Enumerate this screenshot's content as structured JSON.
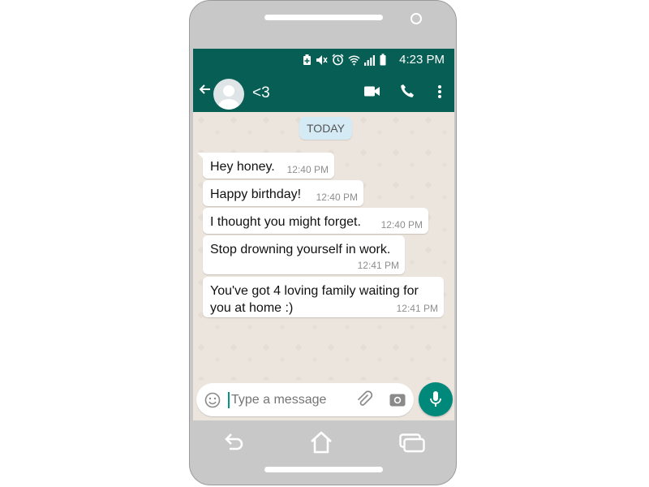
{
  "status_bar": {
    "time": "4:23 PM",
    "icons": [
      "battery-saver-icon",
      "mute-icon",
      "alarm-icon",
      "wifi-icon",
      "signal-icon",
      "battery-icon"
    ]
  },
  "app_bar": {
    "contact_name": "<3",
    "icons": [
      "back-arrow-icon",
      "video-call-icon",
      "phone-call-icon",
      "more-options-icon"
    ]
  },
  "chat": {
    "date_divider": "TODAY",
    "messages": [
      {
        "text": "Hey honey.",
        "time": "12:40 PM"
      },
      {
        "text": "Happy birthday!",
        "time": "12:40 PM"
      },
      {
        "text": "I thought you might forget.",
        "time": "12:40 PM"
      },
      {
        "text": "Stop drowning yourself in work.",
        "time": "12:41 PM"
      },
      {
        "text": "You've got 4 loving family waiting for you at home :)",
        "time": "12:41 PM"
      }
    ]
  },
  "composer": {
    "placeholder": "Type a message",
    "icons": [
      "emoji-icon",
      "attach-icon",
      "camera-icon",
      "mic-icon"
    ]
  },
  "colors": {
    "header": "#075e54",
    "chat_background": "#ece5dd",
    "accent": "#00897b",
    "date_chip": "#d4eaf4"
  }
}
